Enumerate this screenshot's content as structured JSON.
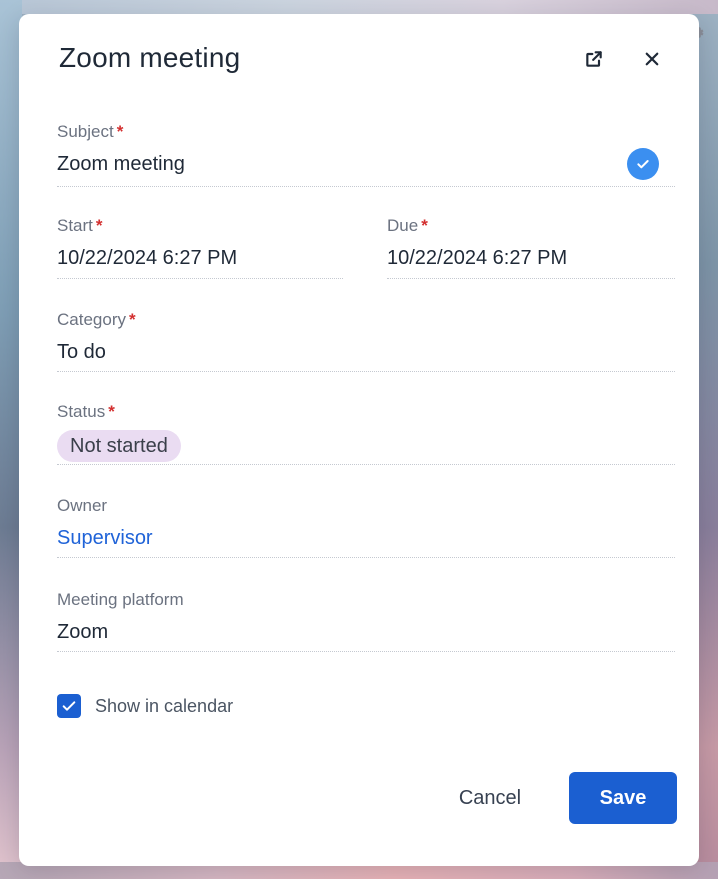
{
  "dialog": {
    "title": "Zoom meeting",
    "icons": {
      "open_external": "open-external-icon",
      "close": "close-icon",
      "settings": "gear-icon"
    }
  },
  "fields": {
    "subject": {
      "label": "Subject",
      "required": "*",
      "value": "Zoom meeting",
      "status_icon": "check-circle-icon"
    },
    "start": {
      "label": "Start",
      "required": "*",
      "value": "10/22/2024 6:27 PM"
    },
    "due": {
      "label": "Due",
      "required": "*",
      "value": "10/22/2024 6:27 PM"
    },
    "category": {
      "label": "Category",
      "required": "*",
      "value": "To do"
    },
    "status": {
      "label": "Status",
      "required": "*",
      "value": "Not started"
    },
    "owner": {
      "label": "Owner",
      "value": "Supervisor"
    },
    "platform": {
      "label": "Meeting platform",
      "value": "Zoom"
    }
  },
  "show_in_calendar": {
    "label": "Show in calendar",
    "checked": true
  },
  "actions": {
    "cancel": "Cancel",
    "save": "Save"
  },
  "colors": {
    "primary": "#1b5fd1",
    "link": "#1f63d8",
    "required": "#d32f2f",
    "status_pill": "#eadcf2",
    "check_circle": "#3b8ff0"
  }
}
